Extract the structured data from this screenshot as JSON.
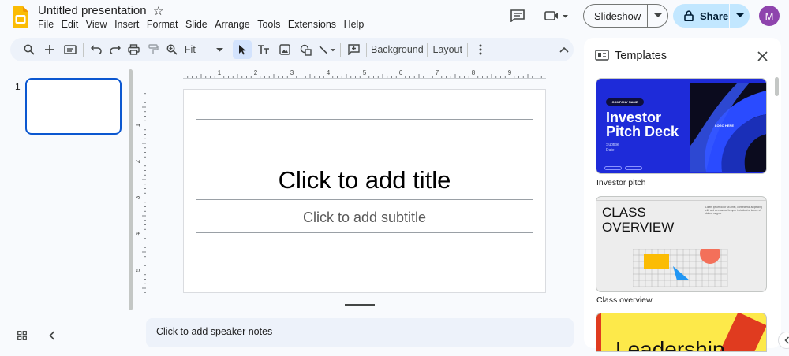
{
  "app": {
    "title": "Untitled presentation",
    "menu": [
      "File",
      "Edit",
      "View",
      "Insert",
      "Format",
      "Slide",
      "Arrange",
      "Tools",
      "Extensions",
      "Help"
    ],
    "slideshow_label": "Slideshow",
    "share_label": "Share",
    "avatar_initial": "M",
    "brand_color": "#fbbc04",
    "accent_color": "#0b57d0"
  },
  "toolbar": {
    "zoom_value": "Fit",
    "background_label": "Background",
    "layout_label": "Layout"
  },
  "filmstrip": {
    "slide_numbers": [
      "1"
    ]
  },
  "slide": {
    "title_placeholder": "Click to add title",
    "subtitle_placeholder": "Click to add subtitle"
  },
  "ruler": {
    "horizontal_numbers": [
      "1",
      "2",
      "3",
      "4",
      "5",
      "6",
      "7",
      "8",
      "9"
    ],
    "vertical_numbers": [
      "1",
      "2",
      "3",
      "4",
      "5"
    ]
  },
  "notes": {
    "placeholder": "Click to add speaker notes"
  },
  "templates_panel": {
    "title": "Templates",
    "items": [
      {
        "caption": "Investor pitch",
        "company_tag": "COMPANY NAME",
        "heading_line1": "Investor",
        "heading_line2": "Pitch Deck",
        "subtitle": "Subtitle",
        "date": "Date",
        "logo_text": "LOGO HERE"
      },
      {
        "caption": "Class overview",
        "heading_line1": "CLASS",
        "heading_line2": "OVERVIEW",
        "body_text": "Lorem ipsum dolor sit amet, consectetur adipiscing elit, sed do eiusmod tempor incididunt ut labore et dolore magna."
      },
      {
        "heading": "Leadership"
      }
    ]
  }
}
